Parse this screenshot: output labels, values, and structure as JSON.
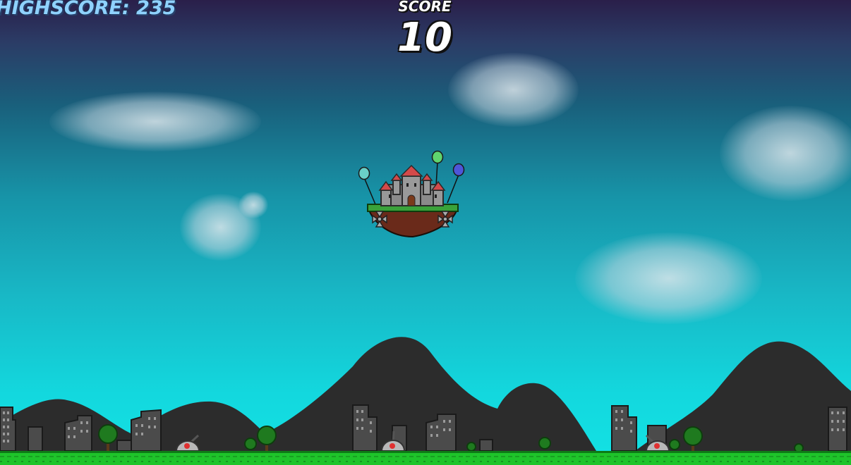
{
  "hud": {
    "highscore_text": "HIGHSCORE: 235",
    "score_label": "SCORE",
    "score_value": "10"
  },
  "player": {
    "name": "floating-castle",
    "balloon_colors": [
      "#6ad0c8",
      "#5fd46e",
      "#4e56d8"
    ]
  },
  "colors": {
    "mountain": "#2c2c2c",
    "ground": "#1ec42a",
    "sky_top": "#2a1f4a",
    "sky_bottom": "#13e2e4"
  }
}
